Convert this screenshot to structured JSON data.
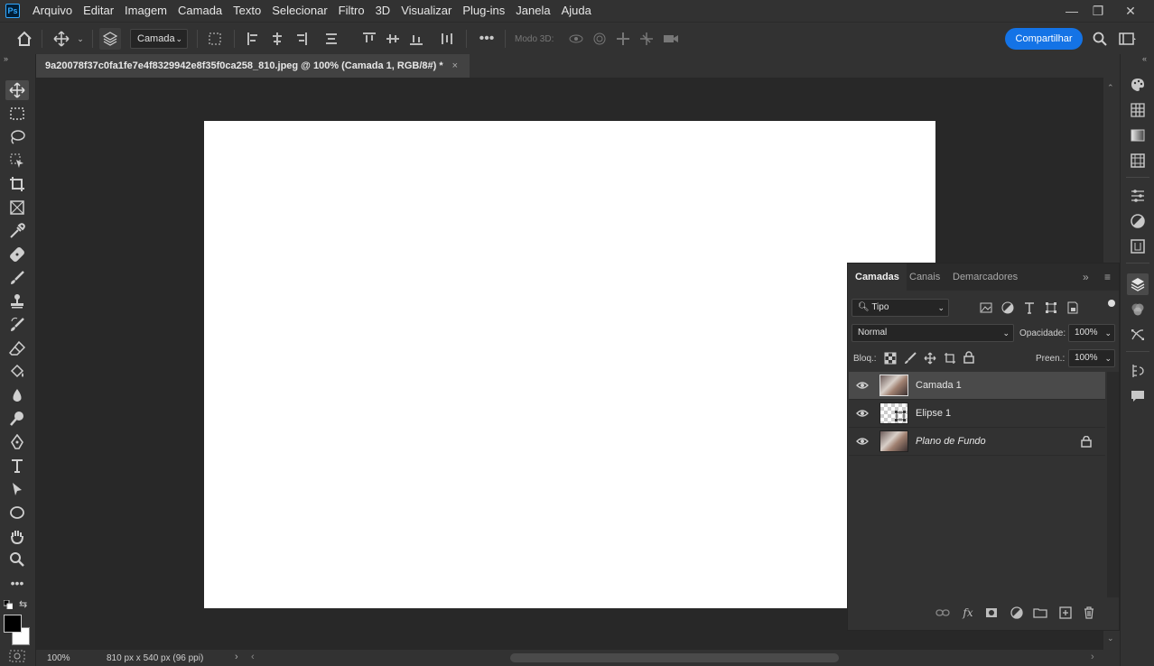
{
  "app": {
    "logo": "Ps"
  },
  "menu": [
    "Arquivo",
    "Editar",
    "Imagem",
    "Camada",
    "Texto",
    "Selecionar",
    "Filtro",
    "3D",
    "Visualizar",
    "Plug-ins",
    "Janela",
    "Ajuda"
  ],
  "window_controls": {
    "minimize": "—",
    "restore": "❐",
    "close": "✕"
  },
  "options": {
    "target_select": "Camada",
    "mode3d_label": "Modo 3D:",
    "share_label": "Compartilhar"
  },
  "document": {
    "tab_title": "9a20078f37c0fa1fe7e4f8329942e8f35f0ca258_810.jpeg @ 100% (Camada 1, RGB/8#) *",
    "close": "×"
  },
  "status": {
    "zoom": "100%",
    "info": "810 px x 540 px (96 ppi)"
  },
  "layers_panel": {
    "tabs": [
      "Camadas",
      "Canais",
      "Demarcadores"
    ],
    "filter_select": "Tipo",
    "blend_mode": "Normal",
    "opacity_label": "Opacidade:",
    "opacity_value": "100%",
    "lock_label": "Bloq.:",
    "fill_label": "Preen.:",
    "fill_value": "100%",
    "layers": [
      {
        "name": "Camada 1",
        "selected": true,
        "locked": false
      },
      {
        "name": "Elipse 1",
        "selected": false,
        "locked": false
      },
      {
        "name": "Plano de Fundo",
        "selected": false,
        "locked": true
      }
    ]
  },
  "colors": {
    "accent": "#1473e6",
    "canvas": "#ffffff",
    "workspace": "#282828",
    "panel": "#323232"
  }
}
